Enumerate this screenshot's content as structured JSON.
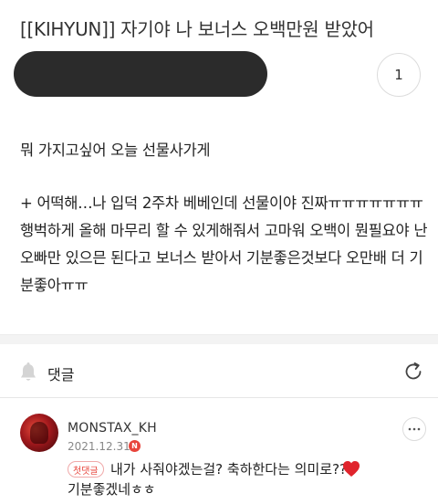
{
  "post": {
    "title": "[[KIHYUN]] 자기야 나 보너스 오백만원 받았어",
    "comment_count": "1",
    "body_line_1": "뭐 가지고싶어 오늘 선물사가게",
    "body_line_2": "+ 어떡해…나 입덕 2주차 베베인데 선물이야 진짜ㅠㅠㅠㅠㅠㅠㅠ행벅하게 올해 마무리 할 수 있게해줘서 고마워 오백이 뭔필요야 난 오빠만 있으믄 된다고 보너스 받아서 기분좋은것보다 오만배 더 기분좋아ㅠㅠ"
  },
  "comments": {
    "header_label": "댓글",
    "items": [
      {
        "username": "MONSTAX_KH",
        "date": "2021.12.31",
        "new_badge": "N",
        "tag": "첫댓글",
        "text_line_1": "내가 사줘야겠는걸? 축하한다는 의미로??",
        "text_line_2": "기분좋겠네ㅎㅎ"
      }
    ]
  },
  "icons": {
    "bell": "bell-icon",
    "refresh": "refresh-icon",
    "more": "more-icon",
    "heart": "heart-icon"
  },
  "colors": {
    "accent_red": "#e8453c",
    "redacted": "#2b2b2b",
    "heart": "#e0242c"
  }
}
